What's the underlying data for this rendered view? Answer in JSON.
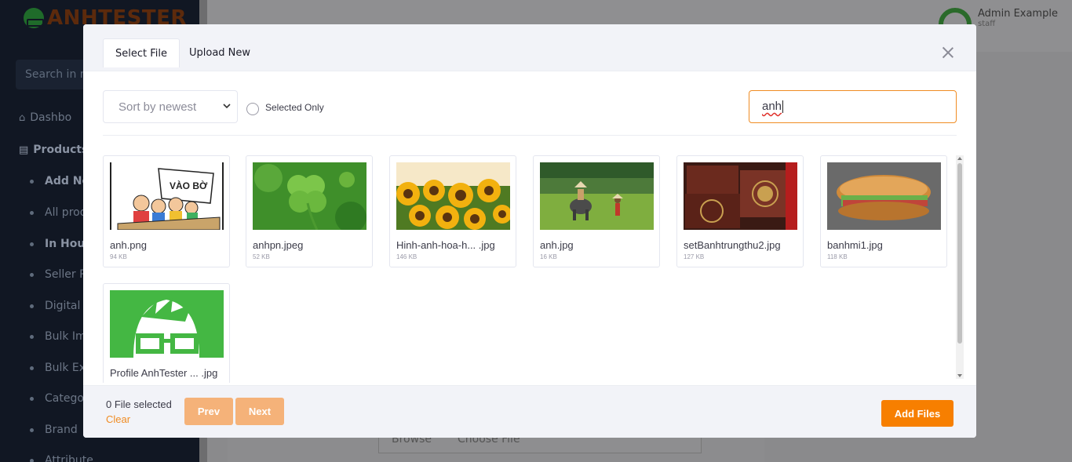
{
  "app": {
    "logo_text": "ANHTESTER",
    "sidebar_search_placeholder": "Search in m",
    "sidebar_items": [
      {
        "label": "Dashbo",
        "style": "icon"
      },
      {
        "label": "Products",
        "style": "bold"
      },
      {
        "label": "Add New",
        "style": "dot-bold"
      },
      {
        "label": "All produ",
        "style": "dot"
      },
      {
        "label": "In House",
        "style": "dot-bold"
      },
      {
        "label": "Seller Pro",
        "style": "dot"
      },
      {
        "label": "Digital P",
        "style": "dot"
      },
      {
        "label": "Bulk Imp",
        "style": "dot"
      },
      {
        "label": "Bulk Exp",
        "style": "dot"
      },
      {
        "label": "Categor",
        "style": "dot"
      },
      {
        "label": "Brand",
        "style": "dot"
      },
      {
        "label": "Attribute",
        "style": "dot"
      }
    ],
    "user_name": "Admin Example",
    "user_role": "staff",
    "browse_label": "Browse",
    "choose_file_label": "Choose File"
  },
  "modal": {
    "tabs": [
      {
        "label": "Select File",
        "active": true
      },
      {
        "label": "Upload New",
        "active": false
      }
    ],
    "sort": {
      "selected": "Sort by newest"
    },
    "selected_only_label": "Selected Only",
    "search_value": "anh",
    "files": [
      {
        "name": "anh.png",
        "size": "94 KB",
        "thumb": "cartoon-kids"
      },
      {
        "name": "anhpn.jpeg",
        "size": "52 KB",
        "thumb": "green-clover"
      },
      {
        "name": "Hinh-anh-hoa-h... .jpg",
        "size": "146 KB",
        "thumb": "sunflowers"
      },
      {
        "name": "anh.jpg",
        "size": "16 KB",
        "thumb": "rice-field-buffalo"
      },
      {
        "name": "setBanhtrungthu2.jpg",
        "size": "127 KB",
        "thumb": "mooncake-box"
      },
      {
        "name": "banhmi1.jpg",
        "size": "118 KB",
        "thumb": "banh-mi-sandwich"
      },
      {
        "name": "Profile AnhTester ... .jpg",
        "size": "",
        "thumb": "anhtester-logo"
      }
    ],
    "footer": {
      "selected_count": "0 File selected",
      "clear_label": "Clear",
      "prev_label": "Prev",
      "next_label": "Next",
      "add_files_label": "Add Files"
    },
    "colors": {
      "accent": "#f77f00",
      "pager": "#f5b279",
      "focus_border": "#f08c23"
    }
  }
}
